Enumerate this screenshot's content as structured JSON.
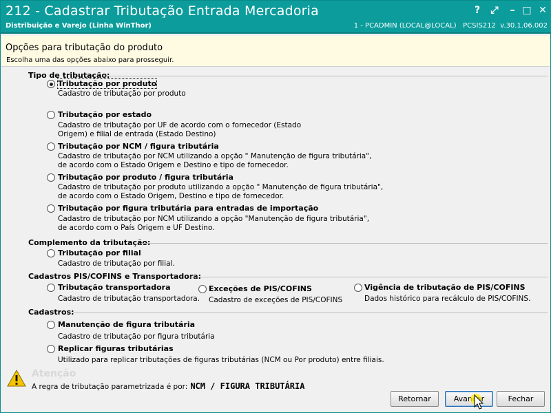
{
  "window": {
    "title": "212 - Cadastrar Tributação Entrada Mercadoria",
    "subtitle": "Distribuição e Varejo (Linha WinThor)",
    "session": "1 - PCADMIN (LOCAL@LOCAL)   PCSIS212  v.30.1.06.002",
    "controls": {
      "help": "?",
      "restore": "⤢",
      "minimize": "–",
      "maximize": "□",
      "close": "✕"
    }
  },
  "banner": {
    "title": "Opções para tributação do produto",
    "subtitle": "Escolha uma das opções abaixo para prosseguir."
  },
  "groups": {
    "tipo": "Tipo de tributação:",
    "complemento": "Complemento da tributação:",
    "pis": "Cadastros PIS/COFINS e Transportadora:",
    "cadastros": "Cadastros:"
  },
  "options": {
    "produto": {
      "label": "Tributação por produto",
      "desc": "Cadastro de tributação por produto",
      "checked": true
    },
    "estado": {
      "label": "Tributação por estado",
      "desc": "Cadastro de tributação por UF de acordo com o fornecedor (Estado\nOrigem) e filial de entrada (Estado Destino)"
    },
    "ncm": {
      "label": "Tributação por NCM / figura tributária",
      "desc": "Cadastro de tributação por NCM utilizando a opção \" Manutenção de figura tributária\",\nde acordo com o Estado Origem e Destino e tipo de fornecedor."
    },
    "produto_figura": {
      "label": "Tributação por produto / figura tributária",
      "desc": "Cadastro de tributação por produto utilizando a opção \" Manutenção de figura tributária\",\nde acordo com o Estado Origem, Destino e tipo de fornecedor."
    },
    "importacao": {
      "label": "Tributação por figura tributária para entradas de importação",
      "desc": "Cadastro de tributação por NCM utilizando a opção \"Manutenção de figura tributária\",\nde acordo com o País Origem e UF Destino."
    },
    "filial": {
      "label": "Tributação por filial",
      "desc": "Cadastro de tributação por filial."
    },
    "transportadora": {
      "label": "Tributação  transportadora",
      "desc": "Cadastro de tributação transportadora."
    },
    "excecoes": {
      "label": "Exceções de PIS/COFINS",
      "desc": "Cadastro de exceções de PIS/COFINS"
    },
    "vigencia": {
      "label": "Vigência de tributação de PIS/COFINS",
      "desc": "Dados histórico para recálculo de PIS/COFINS."
    },
    "manutencao": {
      "label": "Manutenção de figura tributária",
      "desc": "Cadastro de tributação por figura tributária"
    },
    "replicar": {
      "label": "Replicar figuras tributárias",
      "desc": "Utilizado para replicar tributações de figuras tributárias (NCM ou Por produto) entre filiais."
    }
  },
  "attention": {
    "title": "Atenção",
    "text": "A regra de tributação parametrizada é por:",
    "value": "NCM / FIGURA TRIBUTÁRIA"
  },
  "buttons": {
    "back": "Retornar",
    "next": "Avançar",
    "close": "Fechar"
  },
  "colors": {
    "titlebar": "#0c9c9c",
    "banner": "#fffbe3",
    "default_button_border": "#2b6fb5"
  }
}
